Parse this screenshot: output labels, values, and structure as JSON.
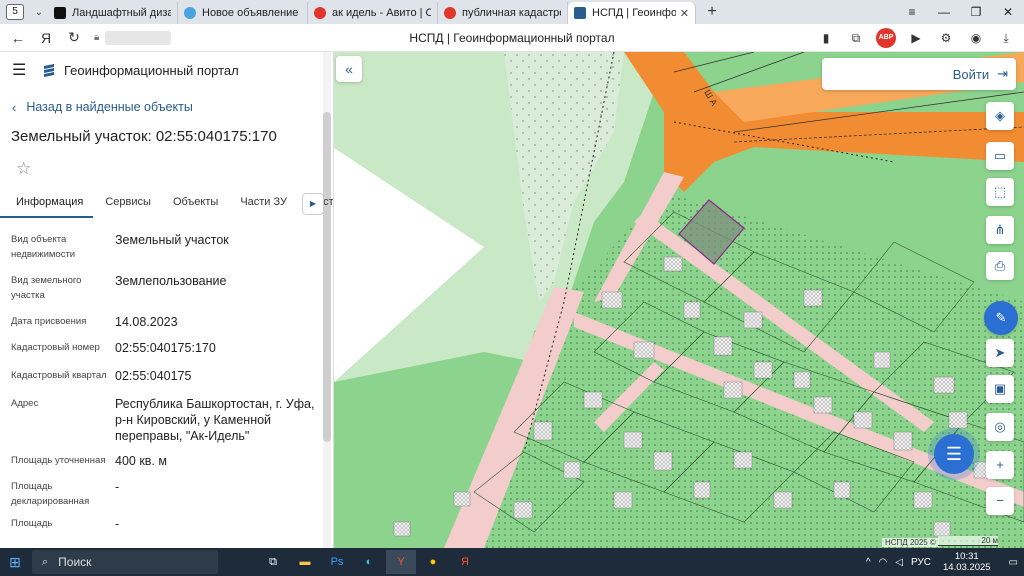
{
  "browser": {
    "tab_count": "5",
    "tabs": [
      {
        "title": "Ландшафтный дизайн | О",
        "color": "#111111"
      },
      {
        "title": "Новое объявление — Об",
        "color": "#4aa3df"
      },
      {
        "title": "ак идель - Авито | Объявл",
        "color": "#e0362c"
      },
      {
        "title": "публичная кадастровая к",
        "color": "#e0362c"
      },
      {
        "title": "НСПД | Геоинформацио",
        "color": "#2a5d8f",
        "active": true
      }
    ],
    "page_title": "НСПД | Геоинформационный портал",
    "abp_label": "ABP"
  },
  "portal": {
    "name": "Геоинформационный портал",
    "back_label": "Назад в найденные объекты",
    "object_title": "Земельный участок: 02:55:040175:170",
    "tabs": [
      "Информация",
      "Сервисы",
      "Объекты",
      "Части ЗУ",
      "Соста"
    ],
    "properties": [
      {
        "key": "Вид объекта недвижимости",
        "value": "Земельный участок"
      },
      {
        "key": "Вид земельного участка",
        "value": "Землепользование"
      },
      {
        "key": "Дата присвоения",
        "value": "14.08.2023"
      },
      {
        "key": "Кадастровый номер",
        "value": "02:55:040175:170"
      },
      {
        "key": "Кадастровый квартал",
        "value": "02:55:040175"
      },
      {
        "key": "Адрес",
        "value": "Республика Башкортостан, г. Уфа, р-н Кировский, у Каменной переправы, \"Ак-Идель\""
      },
      {
        "key": "Площадь уточненная",
        "value": "400 кв. м"
      },
      {
        "key": "Площадь декларированная",
        "value": "-"
      },
      {
        "key": "Площадь",
        "value": "-"
      }
    ]
  },
  "map": {
    "login_label": "Войти",
    "road_label": "Ш А",
    "attribution": "НСПД 2025 ©",
    "scale_label": "20 м",
    "icons": [
      "layers-icon",
      "ruler-icon",
      "select-area-icon",
      "share-icon",
      "print-icon",
      "chat-icon",
      "navigate-icon",
      "map-type-icon",
      "location-icon",
      "zoom-in-icon",
      "zoom-out-icon"
    ]
  },
  "taskbar": {
    "search_label": "Поиск",
    "lang": "РУС",
    "time": "10:31",
    "date": "14.03.2025"
  }
}
